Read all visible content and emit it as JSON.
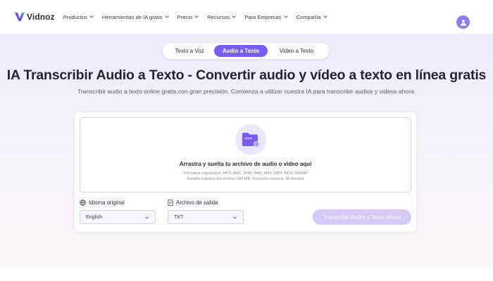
{
  "header": {
    "logo_text": "Vidnoz",
    "nav": [
      {
        "label": "Productos",
        "has_dropdown": true
      },
      {
        "label": "Herramientas de IA gratis",
        "has_dropdown": true
      },
      {
        "label": "Precio",
        "has_dropdown": true
      },
      {
        "label": "Recursos",
        "has_dropdown": true
      },
      {
        "label": "Para Empresas",
        "has_dropdown": true
      },
      {
        "label": "Compañía",
        "has_dropdown": true
      }
    ],
    "avatar_icon": "user-icon"
  },
  "tabs": [
    {
      "label": "Texto a Voz",
      "active": false
    },
    {
      "label": "Audio a Texto",
      "active": true
    },
    {
      "label": "Video a Texto",
      "active": false
    }
  ],
  "hero": {
    "title": "IA Transcribir Audio a Texto - Convertir audio y vídeo a texto en línea gratis",
    "subtitle": "Transcribir audio a texto online gratis con gran precisión. Comienza a utilizar nuestra IA para transcribir audios y videos ahora."
  },
  "upload": {
    "icon": "folder-plus-icon",
    "title": "Arrastra y suelta tu archivo de audio o video aquí",
    "formats": "Formatos soportados: MP3, AAC, M4A, WAV, M4V, MP4, MOV, WEBM",
    "limits": "Tamaño máximo del archivo 200 MB. Duración máxima: 30 minutos"
  },
  "options": {
    "language_label": "Idioma original",
    "language_value": "English",
    "output_label": "Archivo de salida",
    "output_value": "TXT"
  },
  "cta_label": "Transcribir Audio a Texto Ahora",
  "colors": {
    "accent": "#7b5cf0",
    "cta_disabled": "#d4c9f7",
    "avatar": "#8f7cf0"
  }
}
